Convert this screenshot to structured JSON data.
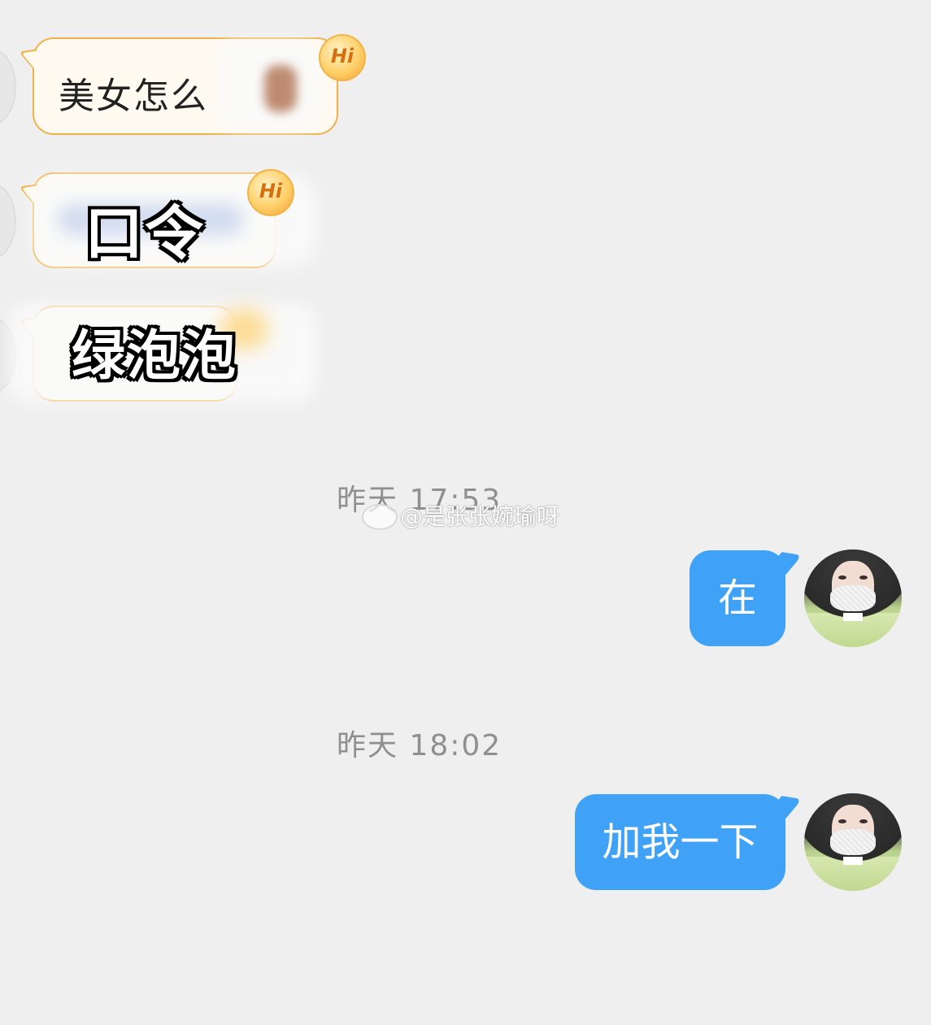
{
  "incoming": {
    "msg1_text": "美女怎么",
    "msg2_overlay": "口令",
    "msg3_overlay": "绿泡泡",
    "hi_badge": "Hi"
  },
  "timestamps": {
    "t1": "昨天 17:53",
    "t2": "昨天 18:02"
  },
  "watermark": "@是张张婉瑜呀",
  "outgoing": {
    "msg1": "在",
    "msg2": "加我一下"
  },
  "colors": {
    "background": "#efefef",
    "outgoing_bubble": "#3fa2f7",
    "incoming_bubble_border": "#f0b04a",
    "timestamp": "#8f8f8f"
  }
}
